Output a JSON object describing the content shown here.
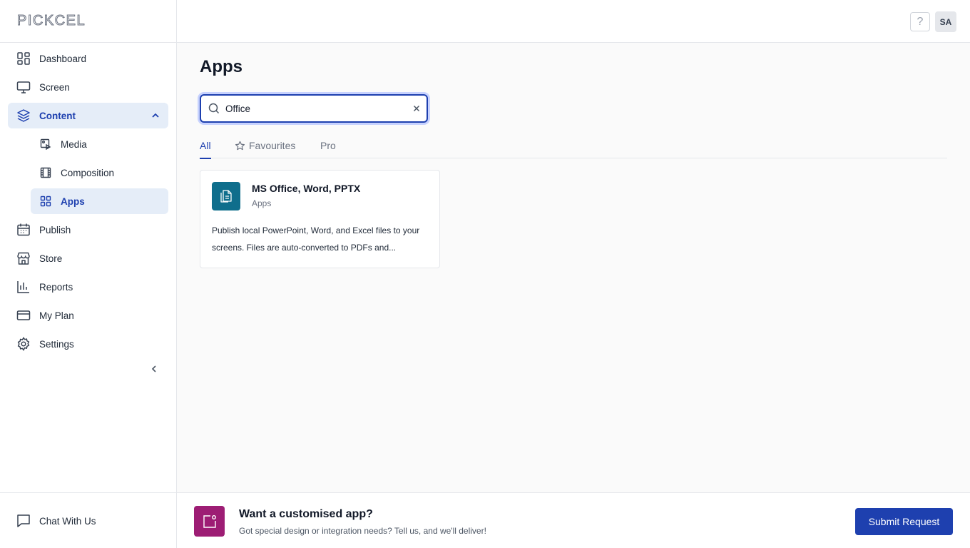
{
  "brand": {
    "logo_text": "PICKCEL"
  },
  "sidebar": {
    "items": [
      {
        "label": "Dashboard"
      },
      {
        "label": "Screen"
      },
      {
        "label": "Content"
      },
      {
        "label": "Media"
      },
      {
        "label": "Composition"
      },
      {
        "label": "Apps"
      },
      {
        "label": "Publish"
      },
      {
        "label": "Store"
      },
      {
        "label": "Reports"
      },
      {
        "label": "My Plan"
      },
      {
        "label": "Settings"
      }
    ],
    "chat_label": "Chat With Us"
  },
  "header": {
    "help_label": "?",
    "avatar_initials": "SA"
  },
  "main": {
    "title": "Apps",
    "search": {
      "value": "Office",
      "placeholder": ""
    },
    "tabs": [
      {
        "label": "All"
      },
      {
        "label": "Favourites"
      },
      {
        "label": "Pro"
      }
    ],
    "cards": [
      {
        "title": "MS Office, Word, PPTX",
        "category": "Apps",
        "description": "Publish local PowerPoint, Word, and Excel files to your screens. Files are auto-converted to PDFs and..."
      }
    ]
  },
  "banner": {
    "title": "Want a customised app?",
    "subtitle": "Got special design or integration needs? Tell us, and we'll deliver!",
    "button_label": "Submit Request"
  },
  "colors": {
    "accent": "#1e40af",
    "active_bg": "#e5edf8",
    "card_icon_bg": "#0f6e8c",
    "banner_icon_bg": "#9d1d74"
  }
}
